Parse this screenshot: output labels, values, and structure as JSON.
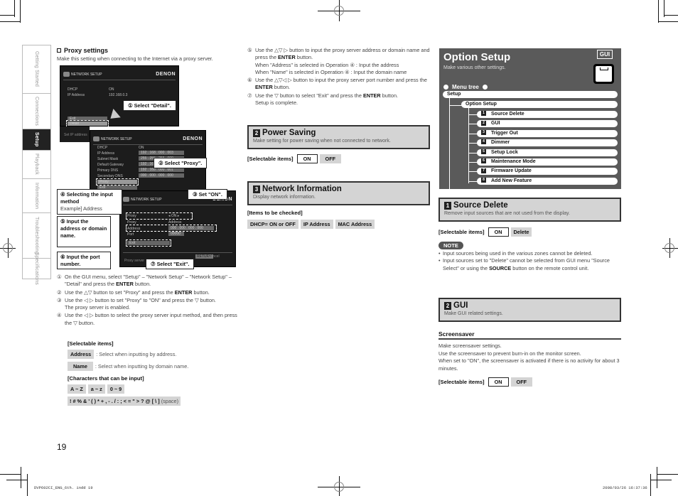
{
  "sidebar": {
    "tabs": [
      {
        "label": "Getting Started",
        "active": false
      },
      {
        "label": "Connections",
        "active": false
      },
      {
        "label": "Setup",
        "active": true
      },
      {
        "label": "Playback",
        "active": false
      },
      {
        "label": "Information",
        "active": false
      },
      {
        "label": "Troubleshooting",
        "active": false
      },
      {
        "label": "Specifications",
        "active": false
      }
    ]
  },
  "proxy": {
    "heading": "Proxy settings",
    "intro": "Make this setting when connecting to the Internet via a proxy server.",
    "screen1": {
      "title": "NETWORK SETUP",
      "brand": "DENON",
      "rows": [
        {
          "label": "DHCP",
          "value": "ON"
        },
        {
          "label": "IP Address",
          "value": "192.168.0.3"
        }
      ],
      "items": [
        "Exit",
        "Detail"
      ],
      "footer": "Set IP address"
    },
    "screen2": {
      "title": "NETWORK SETUP",
      "brand": "DENON",
      "rows": [
        {
          "label": "DHCP",
          "value": "ON"
        },
        {
          "label": "IP Address",
          "value": "192 . 168 . 000 . 003"
        },
        {
          "label": "Subnet Mask",
          "value": "255 . 255 . 255 . 000"
        },
        {
          "label": "Default Gateway",
          "value": "192 . 168 . 000 . 001"
        },
        {
          "label": "Primary DNS",
          "value": "192 . 168 . 000 . 001"
        },
        {
          "label": "Secondary DNS",
          "value": "000 . 000 . 000 . 000"
        }
      ],
      "items": [
        "Proxy",
        "Exit"
      ]
    },
    "screen3": {
      "title": "NETWORK SETUP",
      "brand": "DENON",
      "rows": [
        {
          "label": "Proxy",
          "value": "◂ ON ▸"
        },
        {
          "label": "Proxy",
          "value": "Address"
        },
        {
          "label": "Address",
          "value": "000 . 000 . 000 . 000"
        },
        {
          "label": "Port",
          "value": "00000"
        }
      ],
      "items": [
        "Exit"
      ],
      "footer": "Proxy server",
      "cancel": "Cancel",
      "return_key": "RETURN"
    },
    "callouts": {
      "c1": "① Select \"Detail\".",
      "c2": "② Select \"Proxy\".",
      "c3": "③ Set \"ON\".",
      "c4_title": "④ Selecting the input method",
      "c4_sub": "Example] Address",
      "c5": "⑤ Input the address or domain name.",
      "c6": "⑥ Input the port number.",
      "c7": "⑦ Select \"Exit\"."
    },
    "steps_left": [
      {
        "num": "①",
        "pre": "On the GUI menu, select \"Setup\" – \"Network Setup\" – \"Network Setup\" – \"Detail\" and press the ",
        "bold": "ENTER",
        "post": " button."
      },
      {
        "num": "②",
        "pre": "Use the △▽ button to set \"Proxy\" and press the ",
        "bold": "ENTER",
        "post": " button."
      },
      {
        "num": "③",
        "pre": "Use the ◁ ▷ button to set \"Proxy\" to \"ON\" and press the ▽ button.",
        "bold": "",
        "post": "",
        "extra": "The proxy server is enabled."
      },
      {
        "num": "④",
        "pre": "Use the ◁ ▷ button to select the proxy server input method, and then press the ▽ button.",
        "bold": "",
        "post": ""
      }
    ],
    "selectable_label": "[Selectable items]",
    "selectable": [
      {
        "chip": "Address",
        "desc": ": Select when inputting by address."
      },
      {
        "chip": "Name",
        "desc": ": Select when inputting by domain name."
      }
    ],
    "chars_label": "[Characters that can be input]",
    "chars": [
      "A ~ Z",
      "a ~ z",
      "0 ~ 9"
    ],
    "symbols": "! # % & ' ( ) * + , - . / : ; < = \" > ? @ [ \\ ]",
    "space": "(space)",
    "steps_right": [
      {
        "num": "⑤",
        "pre": "Use the △▽ ▷ button to input the proxy server address or domain name and press the ",
        "bold": "ENTER",
        "post": " button.",
        "extra1": "When \"Address\" is selected in Operation ④ : Input the address",
        "extra2": "When \"Name\" is selected in Operation ④ :    Input the domain name"
      },
      {
        "num": "⑥",
        "pre": "Use the △▽◁ ▷ button to input the proxy server port number and press the ",
        "bold": "ENTER",
        "post": " button."
      },
      {
        "num": "⑦",
        "pre": "Use the ▽ button to select \"Exit\" and press the ",
        "bold": "ENTER",
        "post": " button.",
        "extra1": "Setup is complete."
      }
    ]
  },
  "power_saving": {
    "num": "2",
    "title": "Power Saving",
    "desc": "Make setting for power saving when not connected to network.",
    "selectable_label": "[Selectable items]",
    "options": [
      "ON",
      "OFF"
    ]
  },
  "network_info": {
    "num": "3",
    "title": "Network Information",
    "desc": "Display network information.",
    "checked_label": "[Items to be checked]",
    "items": [
      "DHCP= ON or OFF",
      "IP Address",
      "MAC Address"
    ]
  },
  "option_setup": {
    "title": "Option Setup",
    "subtitle": "Make various other settings.",
    "badge": "GUI",
    "menu_tree_label": "Menu tree",
    "root": "Setup",
    "branch": "Option Setup",
    "items": [
      {
        "num": "1",
        "label": "Source Delete"
      },
      {
        "num": "2",
        "label": "GUI"
      },
      {
        "num": "3",
        "label": "Trigger Out"
      },
      {
        "num": "4",
        "label": "Dimmer"
      },
      {
        "num": "5",
        "label": "Setup Lock"
      },
      {
        "num": "6",
        "label": "Maintenance Mode"
      },
      {
        "num": "7",
        "label": "Firmware Update"
      },
      {
        "num": "8",
        "label": "Add New Feature"
      }
    ]
  },
  "source_delete": {
    "num": "1",
    "title": "Source Delete",
    "desc": "Remove input sources that are not used from the display.",
    "selectable_label": "[Selectable items]",
    "options": [
      "ON",
      "Delete"
    ],
    "note_label": "NOTE",
    "notes": [
      {
        "pre": "Input sources being used in the various zones cannot be deleted.",
        "bold": "",
        "post": ""
      },
      {
        "pre": "Input sources set to \"Delete\" cannot be selected from GUI menu \"Source Select\" or using the ",
        "bold": "SOURCE",
        "post": " button on the remote control unit."
      }
    ]
  },
  "gui": {
    "num": "2",
    "title": "GUI",
    "desc": "Make GUI related settings.",
    "screensaver": {
      "heading": "Screensaver",
      "lines": [
        "Make screensaver settings.",
        "Use the screensaver to prevent burn-in on the monitor screen.",
        "When set to \"ON\", the screensaver is activated if there is no activity for about 3 minutes."
      ],
      "selectable_label": "[Selectable items]",
      "options": [
        "ON",
        "OFF"
      ]
    }
  },
  "page": {
    "number": "19",
    "footer_file": "DVP602CI_ENG_6th. indd   19",
    "footer_date": "2008/03/26   16:37:36"
  }
}
